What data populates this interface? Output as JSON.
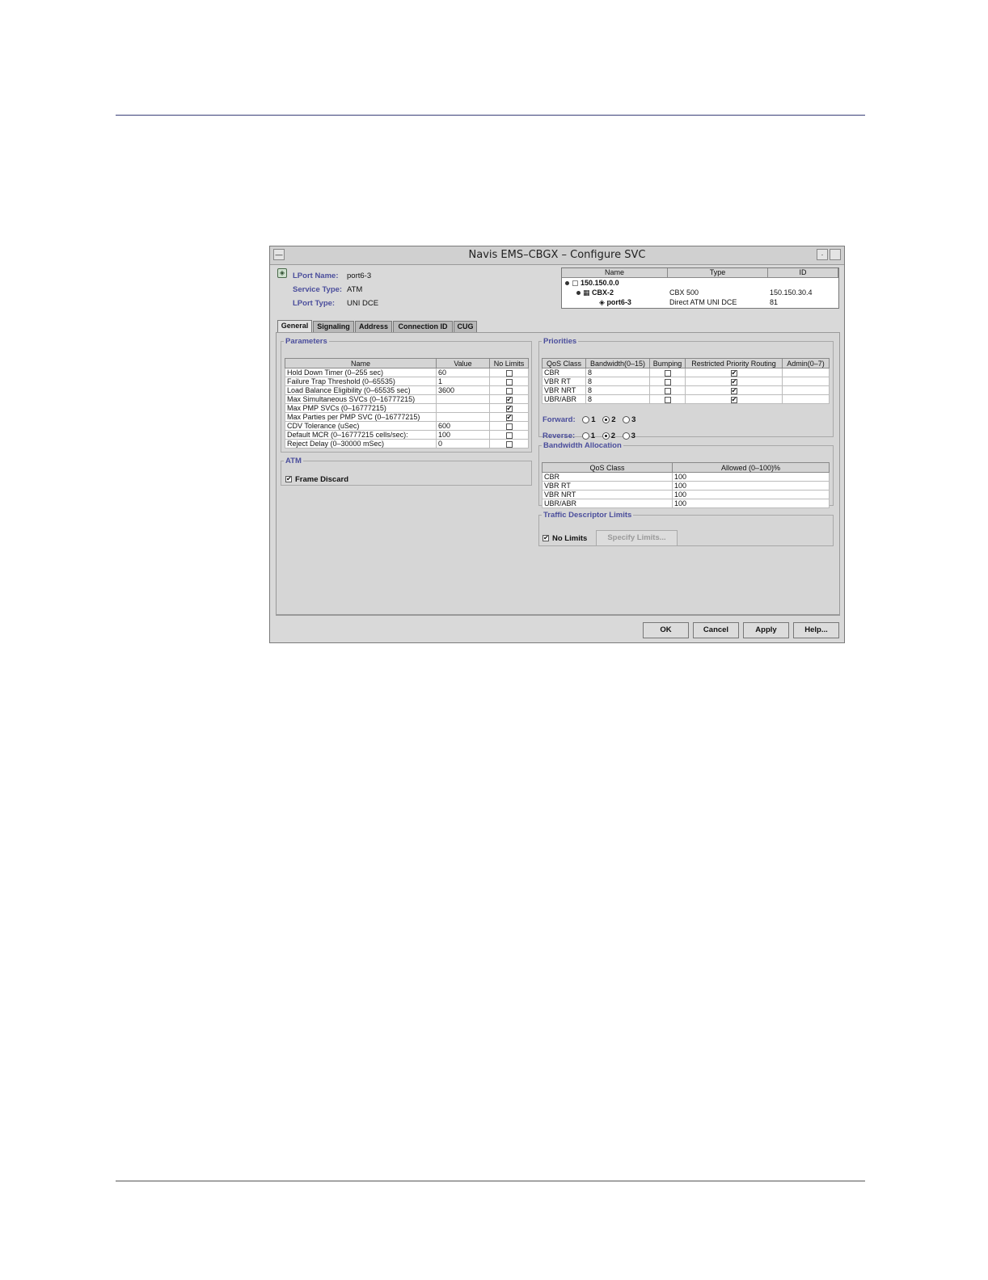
{
  "window": {
    "title": "Navis EMS–CBGX – Configure SVC"
  },
  "lport": {
    "name_label": "LPort Name:",
    "name_value": "port6-3",
    "service_label": "Service Type:",
    "service_value": "ATM",
    "type_label": "LPort Type:",
    "type_value": "UNI DCE"
  },
  "tree": {
    "headers": [
      "Name",
      "Type",
      "ID"
    ],
    "rows": [
      {
        "name": "150.150.0.0",
        "type": "",
        "id": ""
      },
      {
        "name": "CBX-2",
        "type": "CBX 500",
        "id": "150.150.30.4"
      },
      {
        "name": "port6-3",
        "type": "Direct ATM UNI DCE",
        "id": "81"
      }
    ]
  },
  "tabs": [
    "General",
    "Signaling",
    "Address",
    "Connection ID",
    "CUG"
  ],
  "parameters": {
    "legend": "Parameters",
    "headers": [
      "Name",
      "Value",
      "No Limits"
    ],
    "rows": [
      {
        "name": "Hold Down Timer (0–255 sec)",
        "value": "60",
        "nolimit": false
      },
      {
        "name": "Failure Trap Threshold (0–65535)",
        "value": "1",
        "nolimit": false
      },
      {
        "name": "Load Balance Eligibility (0–65535 sec)",
        "value": "3600",
        "nolimit": false
      },
      {
        "name": "Max Simultaneous SVCs (0–16777215)",
        "value": "",
        "nolimit": true
      },
      {
        "name": "Max PMP SVCs (0–16777215)",
        "value": "",
        "nolimit": true
      },
      {
        "name": "Max Parties per PMP SVC (0–16777215)",
        "value": "",
        "nolimit": true
      },
      {
        "name": "CDV Tolerance (uSec)",
        "value": "600",
        "nolimit": false
      },
      {
        "name": "Default MCR (0–16777215 cells/sec):",
        "value": "100",
        "nolimit": false
      },
      {
        "name": "Reject Delay (0–30000 mSec)",
        "value": "0",
        "nolimit": false
      }
    ]
  },
  "atm": {
    "legend": "ATM",
    "frame_discard": "Frame Discard"
  },
  "priorities": {
    "legend": "Priorities",
    "headers": [
      "QoS Class",
      "Bandwidth(0–15)",
      "Bumping",
      "Restricted Priority Routing",
      "Admin(0–7)"
    ],
    "rows": [
      {
        "qos": "CBR",
        "bw": "8",
        "bumping": false,
        "rpr": true,
        "admin": ""
      },
      {
        "qos": "VBR RT",
        "bw": "8",
        "bumping": false,
        "rpr": true,
        "admin": ""
      },
      {
        "qos": "VBR NRT",
        "bw": "8",
        "bumping": false,
        "rpr": true,
        "admin": ""
      },
      {
        "qos": "UBR/ABR",
        "bw": "8",
        "bumping": false,
        "rpr": true,
        "admin": ""
      }
    ],
    "forward_label": "Forward:",
    "reverse_label": "Reverse:",
    "options": [
      "1",
      "2",
      "3"
    ]
  },
  "bandwidth": {
    "legend": "Bandwidth Allocation",
    "headers": [
      "QoS Class",
      "Allowed (0–100)%"
    ],
    "rows": [
      {
        "qos": "CBR",
        "allowed": "100"
      },
      {
        "qos": "VBR RT",
        "allowed": "100"
      },
      {
        "qos": "VBR NRT",
        "allowed": "100"
      },
      {
        "qos": "UBR/ABR",
        "allowed": "100"
      }
    ]
  },
  "traffic": {
    "legend": "Traffic Descriptor Limits",
    "no_limits": "No Limits",
    "specify": "Specify Limits..."
  },
  "buttons": {
    "ok": "OK",
    "cancel": "Cancel",
    "apply": "Apply",
    "help": "Help..."
  }
}
